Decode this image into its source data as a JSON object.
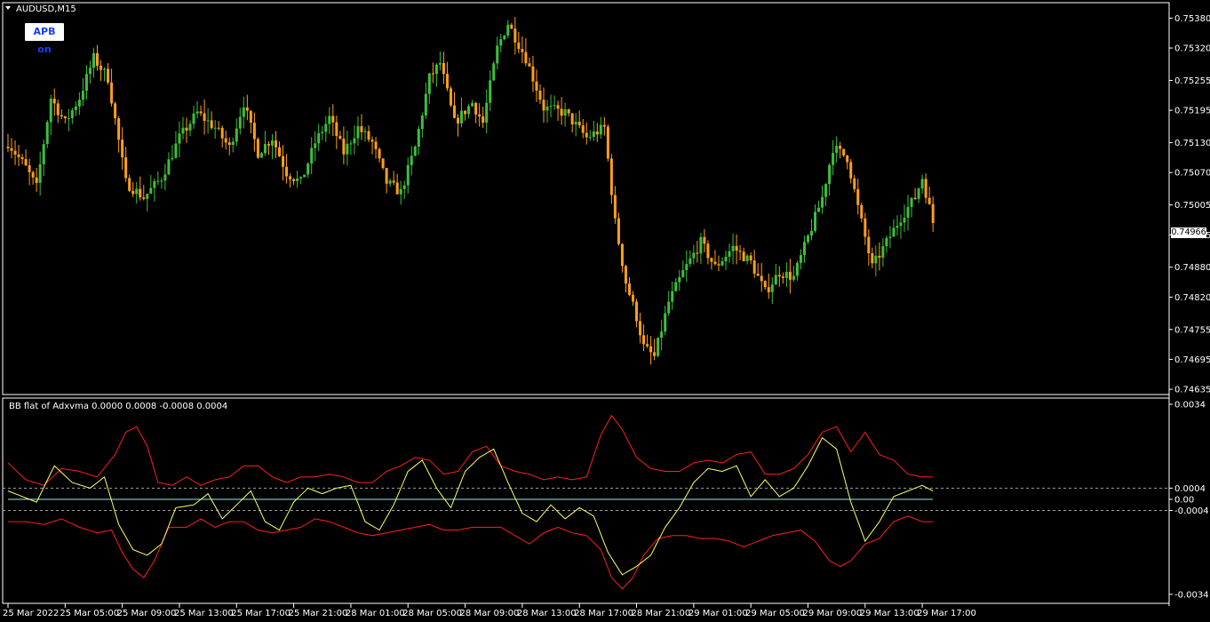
{
  "window": {
    "symbol_title": "AUDUSD,M15",
    "apb_button_label": "APB on",
    "current_price_label": "0.74966"
  },
  "colors": {
    "bull": "#3dbf3d",
    "bear": "#ff9f1a",
    "bb_band": "#ff1e1e",
    "indicator": "#ffff66",
    "zero_line": "#7fd6d6",
    "level_line": "#a0a0a0",
    "frame": "#ffffff"
  },
  "main_chart": {
    "price_labels": [
      "0.75380",
      "0.75320",
      "0.75255",
      "0.75195",
      "0.75130",
      "0.75070",
      "0.75005",
      "0.74945",
      "0.74880",
      "0.74820",
      "0.74755",
      "0.74695",
      "0.74635"
    ],
    "tick_values": [
      0.7538,
      0.7532,
      0.75255,
      0.75195,
      0.7513,
      0.7507,
      0.75005,
      0.74945,
      0.7488,
      0.7482,
      0.74755,
      0.74695,
      0.74635
    ],
    "current_price": 0.74966,
    "price_range": [
      0.74628,
      0.75395
    ]
  },
  "sub_chart": {
    "title": "BB flat of Adxvma  0.0000 0.0008 -0.0008 0.0004",
    "labels": [
      "0.0034",
      "0.0004",
      "0.00",
      "-0.0004",
      "-0.0034"
    ],
    "label_values": [
      0.0034,
      0.0004,
      0.0,
      -0.0004,
      -0.0034
    ],
    "level_lines": [
      0.0004,
      -0.0004
    ],
    "value_range": [
      -0.0035,
      0.0034
    ]
  },
  "time_axis": {
    "labels": [
      "25 Mar 2022",
      "25 Mar 05:00",
      "25 Mar 09:00",
      "25 Mar 13:00",
      "25 Mar 17:00",
      "25 Mar 21:00",
      "28 Mar 01:00",
      "28 Mar 05:00",
      "28 Mar 09:00",
      "28 Mar 13:00",
      "28 Mar 17:00",
      "28 Mar 21:00",
      "29 Mar 01:00",
      "29 Mar 05:00",
      "29 Mar 09:00",
      "29 Mar 13:00",
      "29 Mar 17:00"
    ],
    "label_bar_index": [
      0,
      16,
      32,
      48,
      64,
      80,
      96,
      112,
      128,
      144,
      160,
      176,
      192,
      208,
      224,
      240,
      256
    ]
  },
  "chart_data": {
    "type": "candlestick",
    "close_path": [
      [
        0,
        0.7513
      ],
      [
        5,
        0.7508
      ],
      [
        8,
        0.7504
      ],
      [
        12,
        0.7522
      ],
      [
        16,
        0.7517
      ],
      [
        20,
        0.7522
      ],
      [
        24,
        0.753
      ],
      [
        28,
        0.7526
      ],
      [
        33,
        0.7505
      ],
      [
        38,
        0.7502
      ],
      [
        43,
        0.7506
      ],
      [
        48,
        0.7514
      ],
      [
        53,
        0.7519
      ],
      [
        58,
        0.7516
      ],
      [
        62,
        0.7512
      ],
      [
        66,
        0.7521
      ],
      [
        70,
        0.7511
      ],
      [
        74,
        0.7514
      ],
      [
        78,
        0.7507
      ],
      [
        82,
        0.7505
      ],
      [
        86,
        0.7513
      ],
      [
        90,
        0.7518
      ],
      [
        94,
        0.7511
      ],
      [
        98,
        0.7516
      ],
      [
        102,
        0.7513
      ],
      [
        106,
        0.7505
      ],
      [
        110,
        0.7503
      ],
      [
        114,
        0.7512
      ],
      [
        118,
        0.7526
      ],
      [
        121,
        0.7529
      ],
      [
        125,
        0.7517
      ],
      [
        130,
        0.7521
      ],
      [
        133,
        0.7517
      ],
      [
        137,
        0.7532
      ],
      [
        140,
        0.7537
      ],
      [
        145,
        0.753
      ],
      [
        150,
        0.752
      ],
      [
        156,
        0.7519
      ],
      [
        162,
        0.7514
      ],
      [
        167,
        0.7516
      ],
      [
        170,
        0.7497
      ],
      [
        173,
        0.7485
      ],
      [
        176,
        0.7478
      ],
      [
        178,
        0.7472
      ],
      [
        181,
        0.747
      ],
      [
        185,
        0.7481
      ],
      [
        189,
        0.7487
      ],
      [
        194,
        0.7493
      ],
      [
        198,
        0.7488
      ],
      [
        203,
        0.7492
      ],
      [
        208,
        0.7489
      ],
      [
        212,
        0.7483
      ],
      [
        216,
        0.7487
      ],
      [
        220,
        0.7486
      ],
      [
        224,
        0.7494
      ],
      [
        228,
        0.7502
      ],
      [
        231,
        0.7512
      ],
      [
        235,
        0.751
      ],
      [
        238,
        0.75
      ],
      [
        242,
        0.7488
      ],
      [
        246,
        0.7493
      ],
      [
        250,
        0.7498
      ],
      [
        254,
        0.7502
      ],
      [
        256,
        0.7506
      ],
      [
        259,
        0.7497
      ]
    ],
    "bb_flat_points": [
      [
        0,
        0.0003
      ],
      [
        4,
        0.0001
      ],
      [
        8,
        -0.0001
      ],
      [
        13,
        0.0012
      ],
      [
        18,
        0.0006
      ],
      [
        23,
        0.0004
      ],
      [
        27,
        0.0008
      ],
      [
        31,
        -0.0009
      ],
      [
        35,
        -0.0018
      ],
      [
        39,
        -0.002
      ],
      [
        43,
        -0.0016
      ],
      [
        47,
        -0.0003
      ],
      [
        52,
        -0.0002
      ],
      [
        56,
        0.0002
      ],
      [
        60,
        -0.0007
      ],
      [
        64,
        -0.0002
      ],
      [
        68,
        0.0003
      ],
      [
        72,
        -0.0008
      ],
      [
        76,
        -0.0011
      ],
      [
        80,
        -0.0001
      ],
      [
        84,
        0.0004
      ],
      [
        88,
        0.0002
      ],
      [
        92,
        0.0004
      ],
      [
        96,
        0.0005
      ],
      [
        100,
        -0.0008
      ],
      [
        104,
        -0.0011
      ],
      [
        108,
        -0.0002
      ],
      [
        112,
        0.001
      ],
      [
        116,
        0.0014
      ],
      [
        120,
        0.0004
      ],
      [
        124,
        -0.0003
      ],
      [
        128,
        0.001
      ],
      [
        132,
        0.0015
      ],
      [
        136,
        0.0018
      ],
      [
        140,
        0.0006
      ],
      [
        144,
        -0.0005
      ],
      [
        148,
        -0.0008
      ],
      [
        152,
        -0.0002
      ],
      [
        156,
        -0.0007
      ],
      [
        160,
        -0.0003
      ],
      [
        164,
        -0.0006
      ],
      [
        168,
        -0.0019
      ],
      [
        172,
        -0.0027
      ],
      [
        176,
        -0.0024
      ],
      [
        180,
        -0.002
      ],
      [
        184,
        -0.001
      ],
      [
        188,
        -0.0003
      ],
      [
        192,
        0.0006
      ],
      [
        196,
        0.0011
      ],
      [
        200,
        0.001
      ],
      [
        204,
        0.0012
      ],
      [
        208,
        0.0001
      ],
      [
        212,
        0.0007
      ],
      [
        216,
        0.0001
      ],
      [
        220,
        0.0004
      ],
      [
        224,
        0.0012
      ],
      [
        228,
        0.0022
      ],
      [
        232,
        0.0018
      ],
      [
        236,
        -0.0001
      ],
      [
        240,
        -0.0015
      ],
      [
        244,
        -0.0008
      ],
      [
        248,
        0.0001
      ],
      [
        252,
        0.0003
      ],
      [
        256,
        0.0005
      ],
      [
        259,
        0.0003
      ]
    ],
    "bb_upper": [
      [
        0,
        0.0013
      ],
      [
        5,
        0.0007
      ],
      [
        10,
        0.0005
      ],
      [
        15,
        0.0011
      ],
      [
        20,
        0.001
      ],
      [
        25,
        0.0008
      ],
      [
        30,
        0.0016
      ],
      [
        33,
        0.0024
      ],
      [
        36,
        0.0026
      ],
      [
        39,
        0.0019
      ],
      [
        42,
        0.0006
      ],
      [
        46,
        0.0005
      ],
      [
        50,
        0.0008
      ],
      [
        54,
        0.0005
      ],
      [
        58,
        0.0007
      ],
      [
        62,
        0.0008
      ],
      [
        66,
        0.0012
      ],
      [
        70,
        0.0012
      ],
      [
        74,
        0.0008
      ],
      [
        78,
        0.0006
      ],
      [
        82,
        0.0008
      ],
      [
        86,
        0.0008
      ],
      [
        90,
        0.0009
      ],
      [
        94,
        0.0008
      ],
      [
        98,
        0.0006
      ],
      [
        102,
        0.0006
      ],
      [
        106,
        0.001
      ],
      [
        110,
        0.0012
      ],
      [
        114,
        0.0015
      ],
      [
        118,
        0.0014
      ],
      [
        122,
        0.0009
      ],
      [
        126,
        0.001
      ],
      [
        130,
        0.0017
      ],
      [
        134,
        0.0019
      ],
      [
        138,
        0.0012
      ],
      [
        142,
        0.001
      ],
      [
        146,
        0.0009
      ],
      [
        150,
        0.0007
      ],
      [
        154,
        0.0008
      ],
      [
        158,
        0.0007
      ],
      [
        162,
        0.0008
      ],
      [
        166,
        0.0023
      ],
      [
        169,
        0.003
      ],
      [
        172,
        0.0025
      ],
      [
        176,
        0.0015
      ],
      [
        180,
        0.0011
      ],
      [
        184,
        0.001
      ],
      [
        188,
        0.001
      ],
      [
        192,
        0.0013
      ],
      [
        196,
        0.0014
      ],
      [
        200,
        0.0013
      ],
      [
        204,
        0.0016
      ],
      [
        208,
        0.0017
      ],
      [
        212,
        0.0009
      ],
      [
        216,
        0.0009
      ],
      [
        220,
        0.0011
      ],
      [
        224,
        0.0016
      ],
      [
        228,
        0.0024
      ],
      [
        232,
        0.0026
      ],
      [
        236,
        0.0017
      ],
      [
        240,
        0.0024
      ],
      [
        244,
        0.0016
      ],
      [
        248,
        0.0014
      ],
      [
        252,
        0.0009
      ],
      [
        256,
        0.0008
      ],
      [
        259,
        0.0008
      ]
    ],
    "bb_lower": [
      [
        0,
        -0.0008
      ],
      [
        5,
        -0.0008
      ],
      [
        10,
        -0.0009
      ],
      [
        15,
        -0.0007
      ],
      [
        20,
        -0.001
      ],
      [
        25,
        -0.0012
      ],
      [
        29,
        -0.0011
      ],
      [
        32,
        -0.0019
      ],
      [
        35,
        -0.0025
      ],
      [
        38,
        -0.0028
      ],
      [
        41,
        -0.0022
      ],
      [
        45,
        -0.001
      ],
      [
        50,
        -0.001
      ],
      [
        54,
        -0.0007
      ],
      [
        58,
        -0.001
      ],
      [
        62,
        -0.0008
      ],
      [
        66,
        -0.0008
      ],
      [
        70,
        -0.0011
      ],
      [
        74,
        -0.0012
      ],
      [
        78,
        -0.0011
      ],
      [
        82,
        -0.001
      ],
      [
        86,
        -0.0007
      ],
      [
        90,
        -0.0008
      ],
      [
        94,
        -0.001
      ],
      [
        98,
        -0.0012
      ],
      [
        102,
        -0.0013
      ],
      [
        106,
        -0.0012
      ],
      [
        110,
        -0.0011
      ],
      [
        114,
        -0.001
      ],
      [
        118,
        -0.0009
      ],
      [
        122,
        -0.0011
      ],
      [
        126,
        -0.0011
      ],
      [
        130,
        -0.001
      ],
      [
        134,
        -0.001
      ],
      [
        138,
        -0.001
      ],
      [
        142,
        -0.0013
      ],
      [
        146,
        -0.0016
      ],
      [
        150,
        -0.0012
      ],
      [
        154,
        -0.001
      ],
      [
        158,
        -0.0012
      ],
      [
        162,
        -0.0013
      ],
      [
        166,
        -0.0018
      ],
      [
        169,
        -0.0028
      ],
      [
        172,
        -0.0032
      ],
      [
        175,
        -0.0028
      ],
      [
        178,
        -0.002
      ],
      [
        182,
        -0.0014
      ],
      [
        186,
        -0.0013
      ],
      [
        190,
        -0.0013
      ],
      [
        194,
        -0.0014
      ],
      [
        198,
        -0.0014
      ],
      [
        202,
        -0.0015
      ],
      [
        206,
        -0.0017
      ],
      [
        210,
        -0.0015
      ],
      [
        214,
        -0.0013
      ],
      [
        218,
        -0.0012
      ],
      [
        222,
        -0.0011
      ],
      [
        226,
        -0.0015
      ],
      [
        230,
        -0.0022
      ],
      [
        233,
        -0.0024
      ],
      [
        236,
        -0.0022
      ],
      [
        240,
        -0.0016
      ],
      [
        244,
        -0.0014
      ],
      [
        248,
        -0.0008
      ],
      [
        252,
        -0.0006
      ],
      [
        256,
        -0.0008
      ],
      [
        259,
        -0.0008
      ]
    ]
  }
}
